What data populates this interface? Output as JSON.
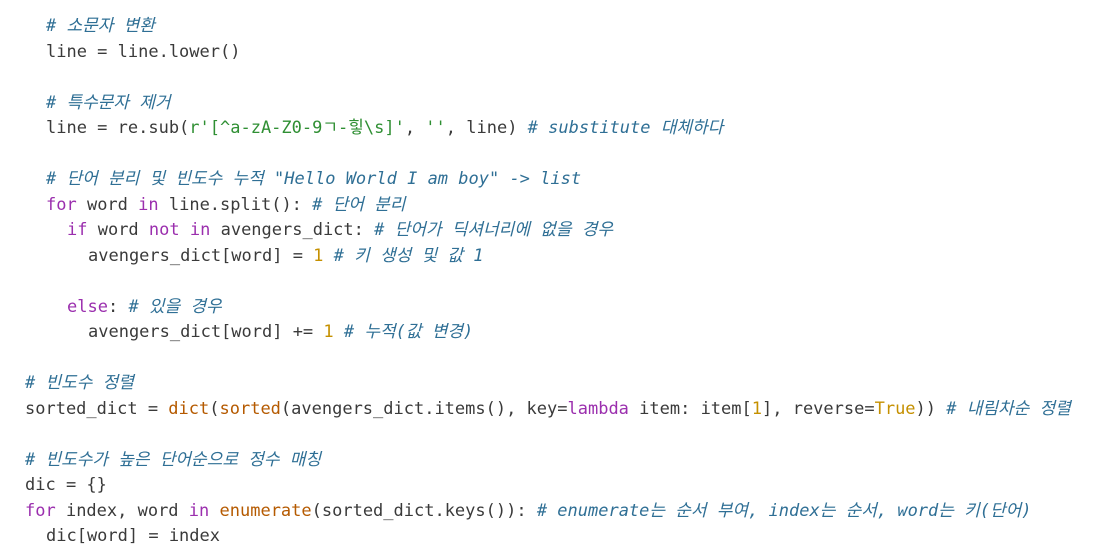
{
  "code": {
    "lines": [
      {
        "indent": 1,
        "tokens": [
          {
            "text": "# 소문자 변환",
            "type": "comment"
          }
        ]
      },
      {
        "indent": 1,
        "tokens": [
          {
            "text": "line = line.lower()",
            "type": "normal"
          }
        ]
      },
      {
        "indent": 0,
        "tokens": []
      },
      {
        "indent": 1,
        "tokens": [
          {
            "text": "# 특수문자 제거",
            "type": "comment"
          }
        ]
      },
      {
        "indent": 1,
        "tokens": [
          {
            "text": "line = re.sub(",
            "type": "normal"
          },
          {
            "text": "r'[^a-zA-Z0-9ㄱ-힣\\s]'",
            "type": "string"
          },
          {
            "text": ", ",
            "type": "normal"
          },
          {
            "text": "''",
            "type": "string"
          },
          {
            "text": ", line) ",
            "type": "normal"
          },
          {
            "text": "# substitute 대체하다",
            "type": "comment"
          }
        ]
      },
      {
        "indent": 0,
        "tokens": []
      },
      {
        "indent": 1,
        "tokens": [
          {
            "text": "# 단어 분리 및 빈도수 누적 \"Hello World I am boy\" -> list",
            "type": "comment"
          }
        ]
      },
      {
        "indent": 1,
        "tokens": [
          {
            "text": "for",
            "type": "keyword"
          },
          {
            "text": " word ",
            "type": "normal"
          },
          {
            "text": "in",
            "type": "keyword"
          },
          {
            "text": " line.split(): ",
            "type": "normal"
          },
          {
            "text": "# 단어 분리",
            "type": "comment"
          }
        ]
      },
      {
        "indent": 2,
        "tokens": [
          {
            "text": "if",
            "type": "keyword"
          },
          {
            "text": " word ",
            "type": "normal"
          },
          {
            "text": "not",
            "type": "keyword"
          },
          {
            "text": " ",
            "type": "normal"
          },
          {
            "text": "in",
            "type": "keyword"
          },
          {
            "text": " avengers_dict: ",
            "type": "normal"
          },
          {
            "text": "# 단어가 딕셔너리에 없을 경우",
            "type": "comment"
          }
        ]
      },
      {
        "indent": 3,
        "tokens": [
          {
            "text": "avengers_dict[word] = ",
            "type": "normal"
          },
          {
            "text": "1",
            "type": "number"
          },
          {
            "text": " ",
            "type": "normal"
          },
          {
            "text": "# 키 생성 및 값 1",
            "type": "comment"
          }
        ]
      },
      {
        "indent": 0,
        "tokens": []
      },
      {
        "indent": 2,
        "tokens": [
          {
            "text": "else",
            "type": "keyword"
          },
          {
            "text": ": ",
            "type": "normal"
          },
          {
            "text": "# 있을 경우",
            "type": "comment"
          }
        ]
      },
      {
        "indent": 3,
        "tokens": [
          {
            "text": "avengers_dict[word] += ",
            "type": "normal"
          },
          {
            "text": "1",
            "type": "number"
          },
          {
            "text": " ",
            "type": "normal"
          },
          {
            "text": "# 누적(값 변경)",
            "type": "comment"
          }
        ]
      },
      {
        "indent": 0,
        "tokens": []
      },
      {
        "indent": 0,
        "tokens": [
          {
            "text": "# 빈도수 정렬",
            "type": "comment"
          }
        ]
      },
      {
        "indent": 0,
        "tokens": [
          {
            "text": "sorted_dict = ",
            "type": "normal"
          },
          {
            "text": "dict",
            "type": "builtin"
          },
          {
            "text": "(",
            "type": "normal"
          },
          {
            "text": "sorted",
            "type": "builtin"
          },
          {
            "text": "(avengers_dict.items(), key=",
            "type": "normal"
          },
          {
            "text": "lambda",
            "type": "keyword"
          },
          {
            "text": " item: item[",
            "type": "normal"
          },
          {
            "text": "1",
            "type": "number"
          },
          {
            "text": "], reverse=",
            "type": "normal"
          },
          {
            "text": "True",
            "type": "boolean"
          },
          {
            "text": ")) ",
            "type": "normal"
          },
          {
            "text": "# 내림차순 정렬",
            "type": "comment"
          }
        ]
      },
      {
        "indent": 0,
        "tokens": []
      },
      {
        "indent": 0,
        "tokens": [
          {
            "text": "# 빈도수가 높은 단어순으로 정수 매칭",
            "type": "comment"
          }
        ]
      },
      {
        "indent": 0,
        "tokens": [
          {
            "text": "dic = {}",
            "type": "normal"
          }
        ]
      },
      {
        "indent": 0,
        "tokens": [
          {
            "text": "for",
            "type": "keyword"
          },
          {
            "text": " index, word ",
            "type": "normal"
          },
          {
            "text": "in",
            "type": "keyword"
          },
          {
            "text": " ",
            "type": "normal"
          },
          {
            "text": "enumerate",
            "type": "builtin"
          },
          {
            "text": "(sorted_dict.keys()): ",
            "type": "normal"
          },
          {
            "text": "# enumerate는 순서 부여, index는 순서, word는 키(단어)",
            "type": "comment"
          }
        ]
      },
      {
        "indent": 1,
        "tokens": [
          {
            "text": "dic[word] = index",
            "type": "normal"
          }
        ]
      }
    ]
  }
}
